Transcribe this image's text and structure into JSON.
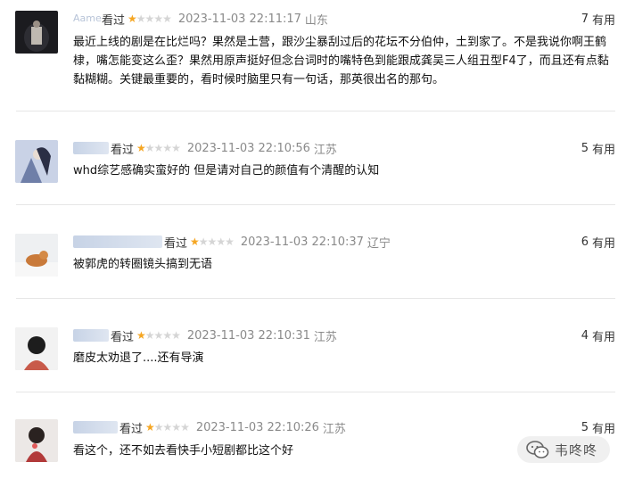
{
  "reviews": [
    {
      "username": "Aame",
      "action": "看过",
      "stars": "★☆☆☆☆",
      "time": "2023-11-03 22:11:17",
      "location": "山东",
      "useful_count": "7",
      "useful_label": "有用",
      "text": "最近上线的剧是在比烂吗？果然是土营，跟沙尘暴刮过后的花坛不分伯仲，土到家了。不是我说你啊王鹤棣，嘴怎能变这么歪？果然用原声挺好但念台词时的嘴特色到能跟成龚吴三人组丑型F4了，而且还有点黏黏糊糊。关键最重要的，看时候时脑里只有一句话，那英很出名的那句。"
    },
    {
      "username": "",
      "action": "看过",
      "stars": "★☆☆☆☆",
      "time": "2023-11-03 22:10:56",
      "location": "江苏",
      "useful_count": "5",
      "useful_label": "有用",
      "text": "whd综艺感确实蛮好的 但是请对自己的颜值有个清醒的认知"
    },
    {
      "username": "",
      "action": "看过",
      "stars": "★☆☆☆☆",
      "time": "2023-11-03 22:10:37",
      "location": "辽宁",
      "useful_count": "6",
      "useful_label": "有用",
      "text": "被郭虎的转圈镜头搞到无语"
    },
    {
      "username": "",
      "action": "看过",
      "stars": "★☆☆☆☆",
      "time": "2023-11-03 22:10:31",
      "location": "江苏",
      "useful_count": "4",
      "useful_label": "有用",
      "text": "磨皮太劝退了....还有导演"
    },
    {
      "username": "",
      "action": "看过",
      "stars": "★☆☆☆☆",
      "time": "2023-11-03 22:10:26",
      "location": "江苏",
      "useful_count": "5",
      "useful_label": "有用",
      "text": "看这个，还不如去看快手小短剧都比这个好"
    }
  ],
  "watermark": {
    "text": "韦咚咚",
    "icon": "wechat-icon"
  },
  "colors": {
    "star_on": "#f5a623",
    "star_off": "#d5d5d5",
    "meta": "#8a8a8a"
  }
}
